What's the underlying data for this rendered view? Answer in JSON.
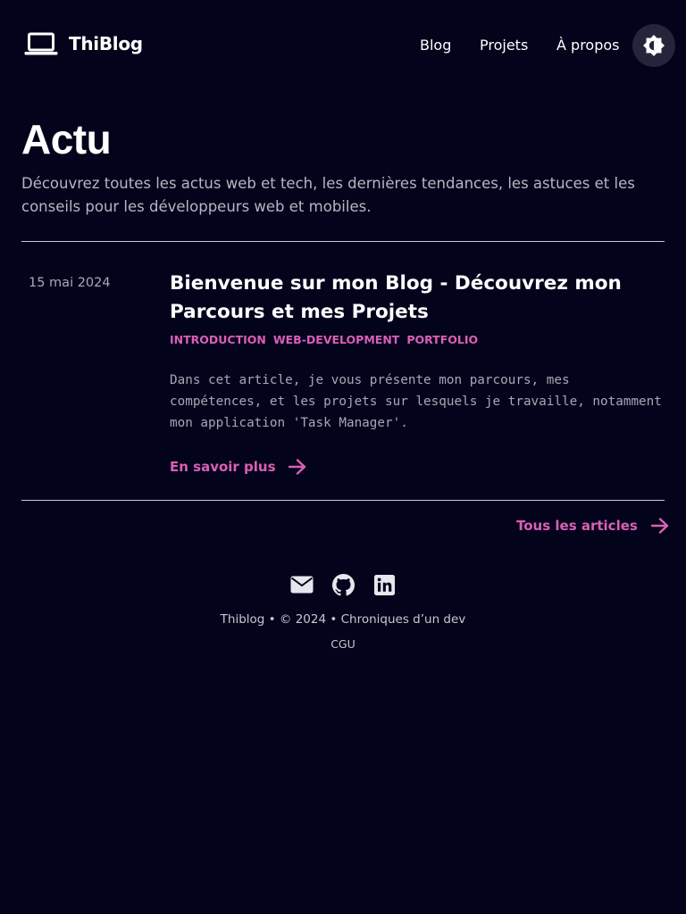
{
  "header": {
    "logo_text": "ThiBlog",
    "nav": [
      {
        "label": "Blog"
      },
      {
        "label": "Projets"
      },
      {
        "label": "À propos"
      }
    ],
    "theme_toggle_icon": "brightness-icon"
  },
  "main": {
    "title": "Actu",
    "description": "Découvrez toutes les actus web et tech, les dernières tendances, les astuces et les conseils pour les développeurs web et mobiles.",
    "posts": [
      {
        "date": "15 mai 2024",
        "title": "Bienvenue sur mon Blog - Découvrez mon Parcours et mes Projets",
        "tags": [
          "introduction",
          "web-development",
          "portfolio"
        ],
        "summary": "Dans cet article, je vous présente mon parcours, mes compétences, et les projets sur lesquels je travaille, notamment mon application 'Task Manager'.",
        "read_more": "En savoir plus"
      }
    ],
    "all_articles": "Tous les articles"
  },
  "footer": {
    "socials": [
      {
        "icon": "mail-icon"
      },
      {
        "icon": "github-icon"
      },
      {
        "icon": "linkedin-icon"
      }
    ],
    "text": "Thiblog • © 2024 • Chroniques d’un dev",
    "link": "CGU"
  },
  "colors": {
    "background": "#03031b",
    "accent": "#db5fb6",
    "text": "#ffffff",
    "muted": "#b6b6c4",
    "toggle_bg": "#24243a"
  }
}
